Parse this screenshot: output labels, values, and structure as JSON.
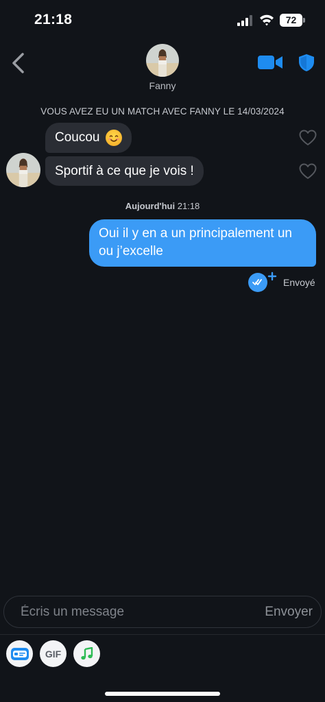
{
  "status_bar": {
    "time": "21:18",
    "battery": "72",
    "icons": [
      "signal-icon",
      "wifi-icon",
      "battery-icon"
    ]
  },
  "header": {
    "back_icon": "chevron-left-icon",
    "contact_name": "Fanny",
    "video_icon": "video-camera-icon",
    "safety_icon": "shield-icon",
    "accent_color": "#1e8cf0"
  },
  "chat": {
    "match_banner": "VOUS AVEZ EU UN MATCH AVEC FANNY LE 14/03/2024",
    "incoming": [
      {
        "text": "Coucou",
        "emoji": "smiling-face-emoji",
        "like_icon": "heart-outline-icon"
      },
      {
        "text": "Sportif à ce que je vois !",
        "like_icon": "heart-outline-icon"
      }
    ],
    "timestamp_day": "Aujourd'hui",
    "timestamp_time": "21:18",
    "outgoing": [
      {
        "line1": "Oui il y en a un principalement un",
        "line2": "ou j’excelle"
      }
    ],
    "outgoing_color": "#3b9bf6",
    "status": "Envoyé",
    "status_icon": "double-check-plus-icon"
  },
  "composer": {
    "placeholder": "Écris un message",
    "send_label": "Envoyer"
  },
  "toolbar": {
    "buttons": [
      {
        "icon": "id-card-icon"
      },
      {
        "label": "GIF"
      },
      {
        "icon": "music-note-icon"
      }
    ]
  }
}
